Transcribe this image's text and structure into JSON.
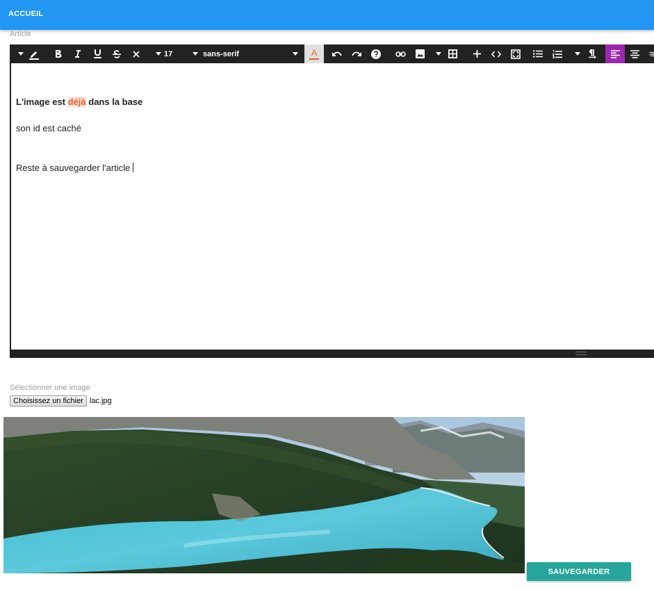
{
  "appbar": {
    "home_label": "ACCUEIL",
    "color": "#2196f3"
  },
  "article": {
    "label": "Article",
    "toolbar": {
      "font_size": "17",
      "font_family": "sans-serif",
      "color_letter": "A",
      "icons": [
        "pen-icon",
        "bold-icon",
        "italic-icon",
        "underline-icon",
        "strikethrough-icon",
        "clear-format-icon",
        "undo-icon",
        "redo-icon",
        "help-icon",
        "link-icon",
        "image-icon",
        "table-icon",
        "plus-icon",
        "code-icon",
        "fullscreen-icon",
        "bullet-list-icon",
        "numbered-list-icon",
        "paragraph-icon",
        "align-left-icon",
        "align-center-icon",
        "align-right-icon"
      ],
      "active_color": "#9c27b0",
      "text_color": "#f05a28"
    },
    "content": {
      "heading_before": "L'image est ",
      "heading_highlight": "déjà",
      "heading_after": " dans la base",
      "line1": "son id est caché",
      "line2": "Reste à sauvegarder l'article"
    }
  },
  "image_field": {
    "label": "Sélectionner une image",
    "button_label": "Choisissez un fichier",
    "file_name": "lac.jpg"
  },
  "save_button": {
    "label": "SAUVEGARDER",
    "color": "#26a69a"
  }
}
